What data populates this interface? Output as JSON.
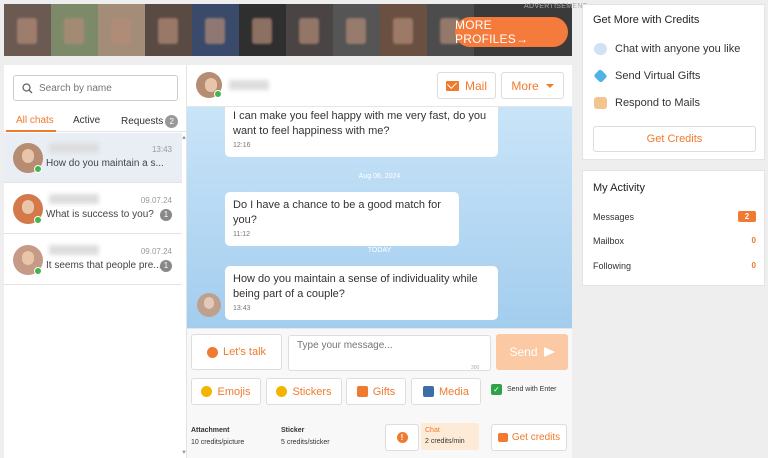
{
  "ad": {
    "label": "ADVERTISEMENT",
    "cta": "MORE PROFILES→",
    "photo_count": 10
  },
  "search": {
    "placeholder": "Search by name"
  },
  "tabs": {
    "all": "All chats",
    "active": "Active",
    "requests": "Requests",
    "requests_count": "2"
  },
  "chats": [
    {
      "time": "13:43",
      "preview": "How do you maintain a s...",
      "unread": "",
      "selected": true
    },
    {
      "time": "09.07.24",
      "preview": "What is success to you?",
      "unread": "1",
      "selected": false
    },
    {
      "time": "09.07.24",
      "preview": "It seems that people pre...",
      "unread": "1",
      "selected": false
    }
  ],
  "header": {
    "mail": "Mail",
    "more": "More"
  },
  "messages": [
    {
      "text": "I can make you feel happy with me very fast, do you want to feel happiness with me?",
      "time": "12:16"
    },
    {
      "date": "Aug 06, 2024"
    },
    {
      "text": "Do I have a chance to be a good match for you?",
      "time": "11:12"
    },
    {
      "date": "TODAY"
    },
    {
      "text": "How do you maintain a sense of individuality while being part of a couple?",
      "time": "13:43"
    }
  ],
  "composer": {
    "lets_talk": "Let's talk",
    "placeholder": "Type your message...",
    "counter": "300",
    "send": "Send",
    "emojis": "Emojis",
    "stickers": "Stickers",
    "gifts": "Gifts",
    "media": "Media",
    "send_with_enter": "Send with Enter"
  },
  "pricing": {
    "attachment_label": "Attachment",
    "attachment_price": "10 credits/picture",
    "sticker_label": "Sticker",
    "sticker_price": "5 credits/sticker",
    "chat_label": "Chat",
    "chat_price": "2 credits/min",
    "get_credits": "Get credits"
  },
  "credits_card": {
    "title": "Get More with Credits",
    "items": [
      "Chat with anyone you like",
      "Send Virtual Gifts",
      "Respond to Mails"
    ],
    "button": "Get Credits"
  },
  "activity": {
    "title": "My Activity",
    "rows": [
      {
        "label": "Messages",
        "value": "2"
      },
      {
        "label": "Mailbox",
        "value": "0"
      },
      {
        "label": "Following",
        "value": "0"
      }
    ]
  },
  "colors": {
    "accent": "#f07a2f",
    "online": "#43b549",
    "chat_bg_top": "#c9e4f8",
    "chat_bg_bottom": "#a3cdee"
  }
}
